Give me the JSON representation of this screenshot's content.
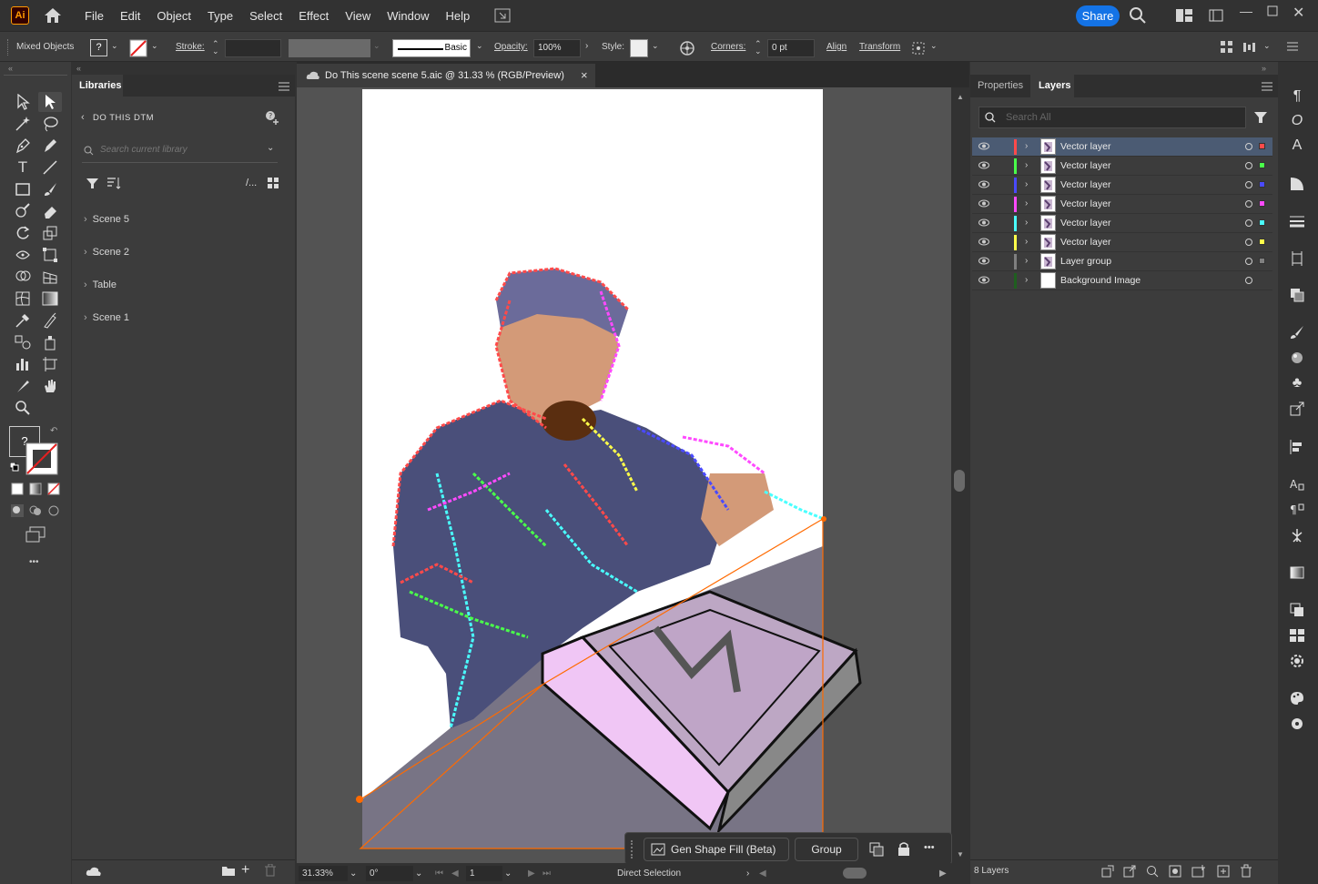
{
  "app": {
    "logo": "Ai",
    "menu": [
      "File",
      "Edit",
      "Object",
      "Type",
      "Select",
      "Effect",
      "View",
      "Window",
      "Help"
    ],
    "share_label": "Share"
  },
  "controlbar": {
    "selection_type": "Mixed Objects",
    "fill_label": "?",
    "stroke_label": "Stroke:",
    "brush_label": "Basic",
    "opacity_label": "Opacity:",
    "opacity_value": "100%",
    "style_label": "Style:",
    "corners_label": "Corners:",
    "corners_value": "0 pt",
    "align_label": "Align",
    "transform_label": "Transform"
  },
  "libraries": {
    "tab_label": "Libraries",
    "library_name": "DO THIS DTM",
    "search_placeholder": "Search current library",
    "groups": [
      "Scene 5",
      "Scene 2",
      "Table",
      "Scene 1"
    ]
  },
  "document": {
    "tab_title": "Do This scene scene 5.aic @ 31.33 % (RGB/Preview)",
    "close_glyph": "×"
  },
  "layers_panel": {
    "tabs": [
      "Properties",
      "Layers"
    ],
    "search_placeholder": "Search All",
    "layers": [
      {
        "name": "Vector layer",
        "color": "#ff4a4a",
        "selected": true
      },
      {
        "name": "Vector layer",
        "color": "#4aff4a",
        "selected": false
      },
      {
        "name": "Vector layer",
        "color": "#4a4aff",
        "selected": false
      },
      {
        "name": "Vector layer",
        "color": "#ff4aff",
        "selected": false
      },
      {
        "name": "Vector layer",
        "color": "#4affff",
        "selected": false
      },
      {
        "name": "Vector layer",
        "color": "#ffff4a",
        "selected": false
      },
      {
        "name": "Layer group",
        "color": "#808080",
        "selected": false
      },
      {
        "name": "Background Image",
        "color": "#1f5f1f",
        "selected": false
      }
    ],
    "footer_count": "8 Layers"
  },
  "context_bar": {
    "gen_fill_label": "Gen Shape Fill (Beta)",
    "group_label": "Group",
    "more_glyph": "•••"
  },
  "statusbar": {
    "zoom": "31.33%",
    "rotation": "0°",
    "artboard": "1",
    "tool": "Direct Selection"
  },
  "toolbar": {
    "fill_question": "?",
    "more_glyph": "•••"
  }
}
